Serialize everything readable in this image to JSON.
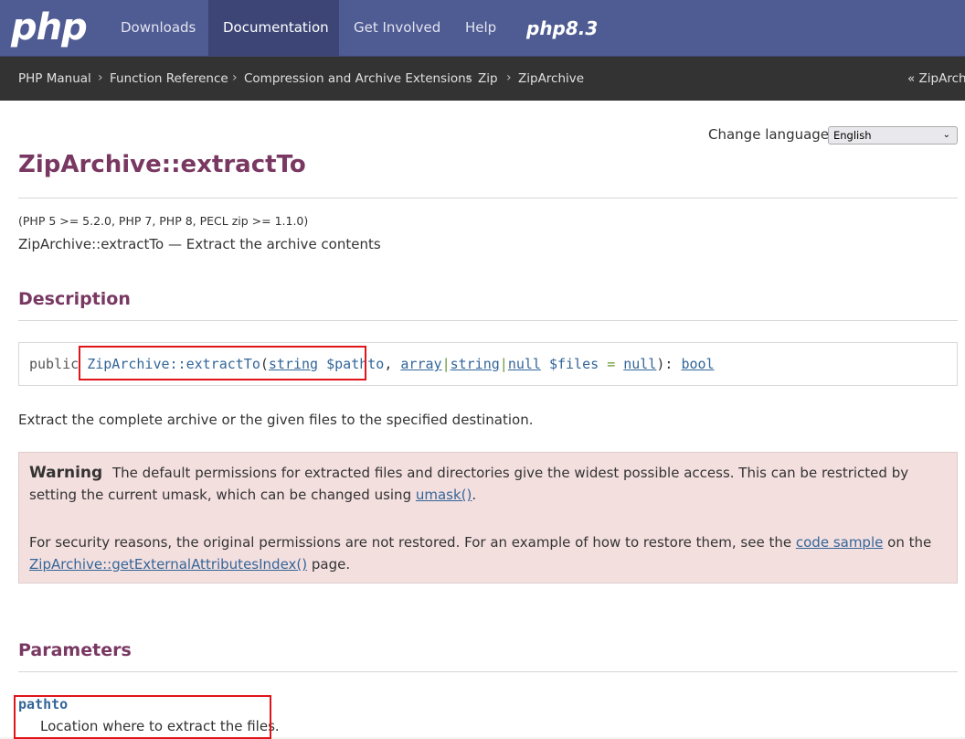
{
  "nav": {
    "logo": "php",
    "items": [
      "Downloads",
      "Documentation",
      "Get Involved",
      "Help"
    ],
    "active": "Documentation",
    "version_logo": "php8.3"
  },
  "breadcrumb": {
    "items": [
      "PHP Manual",
      "Function Reference",
      "Compression and Archive Extensions",
      "Zip",
      "ZipArchive"
    ],
    "separator": "›",
    "prev": "« ZipArchi"
  },
  "language": {
    "label": "Change language:",
    "selected": "English"
  },
  "page": {
    "title": "ZipArchive::extractTo",
    "versions": "(PHP 5 >= 5.2.0, PHP 7, PHP 8, PECL zip >= 1.1.0)",
    "refpurpose": "ZipArchive::extractTo — Extract the archive contents"
  },
  "description": {
    "heading": "Description",
    "synopsis": {
      "modifier": "public",
      "method": "ZipArchive::extractTo",
      "open": "(",
      "p1_type": "string",
      "p1_name": "$pathto",
      "comma": ",",
      "p2_type_a": "array",
      "pipe": "|",
      "p2_type_b": "string",
      "p2_type_c": "null",
      "p2_name": "$files",
      "eq": "=",
      "p2_default": "null",
      "close": "):",
      "return_type": "bool"
    },
    "text": "Extract the complete archive or the given files to the specified destination."
  },
  "warning": {
    "title": "Warning",
    "text1": "The default permissions for extracted files and directories give the widest possible access. This can be restricted by setting the current umask, which can be changed using",
    "link1": "umask()",
    "after1": ".",
    "text2a": "For security reasons, the original permissions are not restored. For an example of how to restore them, see the",
    "link2": "code sample",
    "text2b": "on the",
    "link3": "ZipArchive::getExternalAttributesIndex()",
    "text2c": "page."
  },
  "parameters": {
    "heading": "Parameters",
    "items": [
      {
        "name": "pathto",
        "desc": "Location where to extract the files."
      }
    ]
  }
}
